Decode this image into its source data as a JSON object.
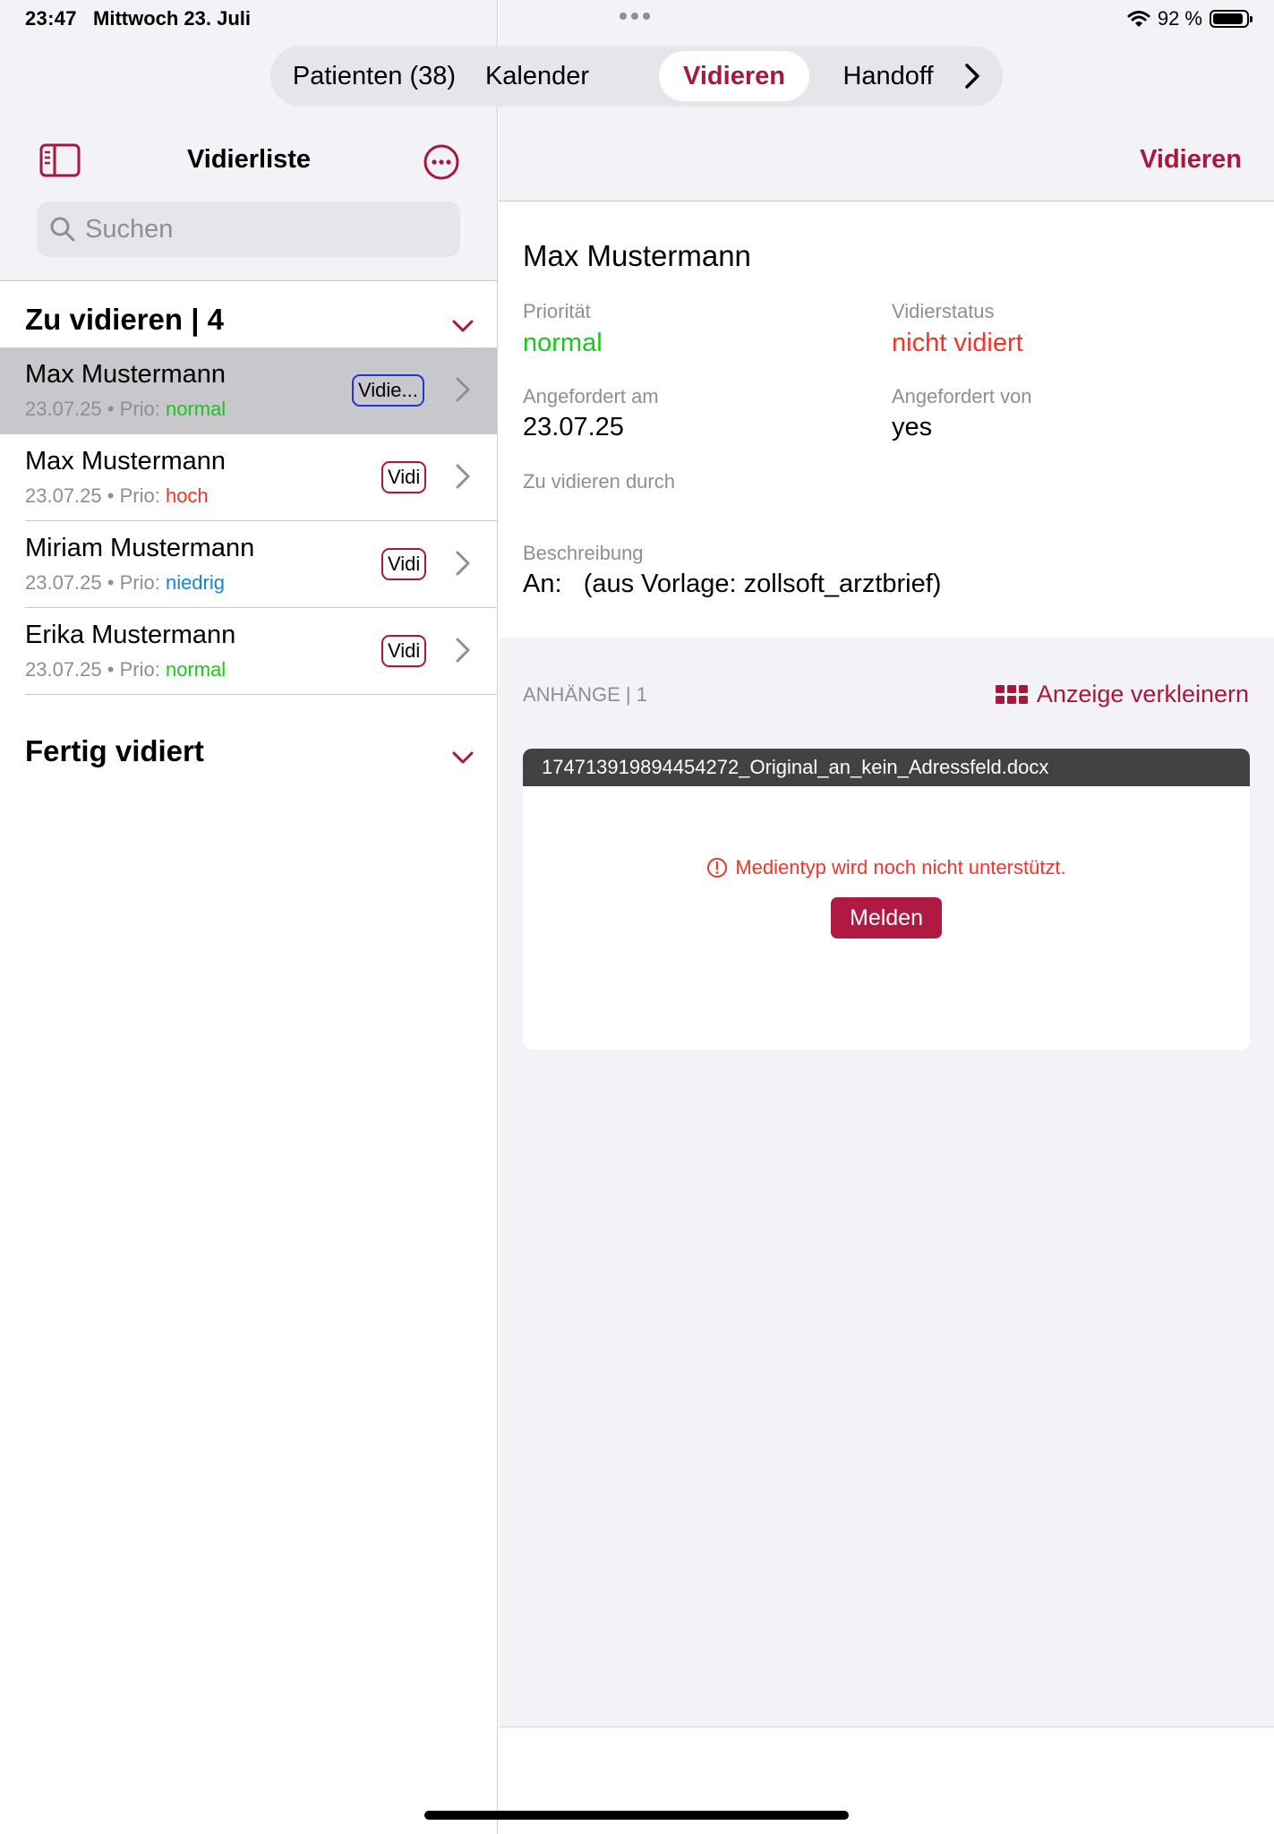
{
  "status_bar": {
    "time": "23:47",
    "date": "Mittwoch 23. Juli",
    "battery": "92 %",
    "battery_level": 0.92,
    "wifi_icon": "wifi-icon"
  },
  "tabs": [
    {
      "label": "Patienten (38)",
      "active": false
    },
    {
      "label": "Kalender",
      "active": false
    },
    {
      "label": "Vidieren",
      "active": true
    },
    {
      "label": "Handoff",
      "active": false
    }
  ],
  "sidebar": {
    "title": "Vidierliste",
    "search_placeholder": "Suchen",
    "section_open": "Zu vidieren | 4",
    "section_done": "Fertig vidiert",
    "prio_prefix": "Prio:",
    "items": [
      {
        "name": "Max Mustermann",
        "date": "23.07.25",
        "prio": "normal",
        "badge": "Vidie...",
        "selected": true
      },
      {
        "name": "Max Mustermann",
        "date": "23.07.25",
        "prio": "hoch",
        "badge": "Vidi",
        "selected": false
      },
      {
        "name": "Miriam Mustermann",
        "date": "23.07.25",
        "prio": "niedrig",
        "badge": "Vidi",
        "selected": false
      },
      {
        "name": "Erika Mustermann",
        "date": "23.07.25",
        "prio": "normal",
        "badge": "Vidi",
        "selected": false
      }
    ]
  },
  "detail": {
    "action": "Vidieren",
    "patient": "Max Mustermann",
    "priority_label": "Priorität",
    "priority_value": "normal",
    "status_label": "Vidierstatus",
    "status_value": "nicht vidiert",
    "requested_on_label": "Angefordert am",
    "requested_on_value": "23.07.25",
    "requested_by_label": "Angefordert von",
    "requested_by_value": "yes",
    "verify_by_label": "Zu vidieren durch",
    "description_label": "Beschreibung",
    "description_value": "An:   (aus Vorlage: zollsoft_arztbrief)"
  },
  "attachments": {
    "label": "ANHÄNGE | 1",
    "toggle_label": "Anzeige verkleinern",
    "file_name": "174713919894454272_Original_an_kein_Adressfeld.docx",
    "error": "Medientyp wird noch nicht unterstützt.",
    "report_button": "Melden"
  },
  "colors": {
    "accent": "#a8173c",
    "green": "#1ec51e",
    "red": "#f0352a",
    "blue": "#1784d6"
  }
}
